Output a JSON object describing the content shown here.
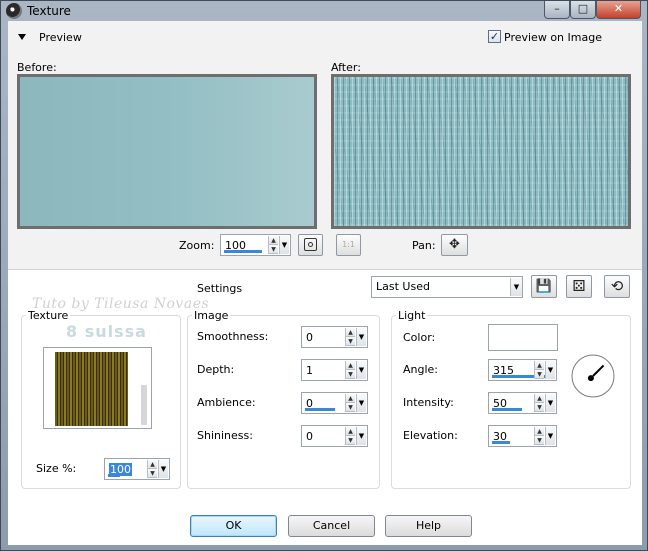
{
  "window": {
    "title": "Texture",
    "icon": "camera-icon"
  },
  "titlebar_buttons": {
    "minimize": "–",
    "maximize": "□",
    "close": "✕"
  },
  "preview": {
    "section_label": "Preview",
    "preview_on_image_label": "Preview on Image",
    "preview_on_image_checked": true,
    "check_mark": "✓",
    "before_label": "Before:",
    "after_label": "After:",
    "zoom_label": "Zoom:",
    "zoom_value": "100",
    "pan_label": "Pan:",
    "actual_size_label": "1:1",
    "pan_glyph": "✥"
  },
  "settings": {
    "label": "Settings",
    "preset_value": "Last Used",
    "save_icon": "floppy-icon",
    "random_icon": "dice-icon",
    "reset_icon": "reset-icon",
    "save_glyph": "💾",
    "random_glyph": "⚄",
    "reset_glyph": "⟲"
  },
  "watermarks": {
    "line1": "Tuto by Tileusa Novaes",
    "line2": "8 sulssa"
  },
  "texture": {
    "legend": "Texture",
    "size_label": "Size %:",
    "size_value": "100",
    "swatch_colors": [
      "#6a5a13",
      "#3a2f07",
      "#8a7a25"
    ]
  },
  "image": {
    "legend": "Image",
    "rows": [
      {
        "label": "Smoothness:",
        "value": "0"
      },
      {
        "label": "Depth:",
        "value": "1"
      },
      {
        "label": "Ambience:",
        "value": "0"
      },
      {
        "label": "Shininess:",
        "value": "0"
      }
    ]
  },
  "light": {
    "legend": "Light",
    "color_label": "Color:",
    "color_value": "#ffffff",
    "rows": [
      {
        "label": "Angle:",
        "value": "315"
      },
      {
        "label": "Intensity:",
        "value": "50"
      },
      {
        "label": "Elevation:",
        "value": "30"
      }
    ],
    "angle_degrees": 315
  },
  "buttons": {
    "ok": "OK",
    "cancel": "Cancel",
    "help": "Help"
  },
  "spin_glyphs": {
    "up": "▲",
    "down": "▼",
    "drop": "▼"
  }
}
